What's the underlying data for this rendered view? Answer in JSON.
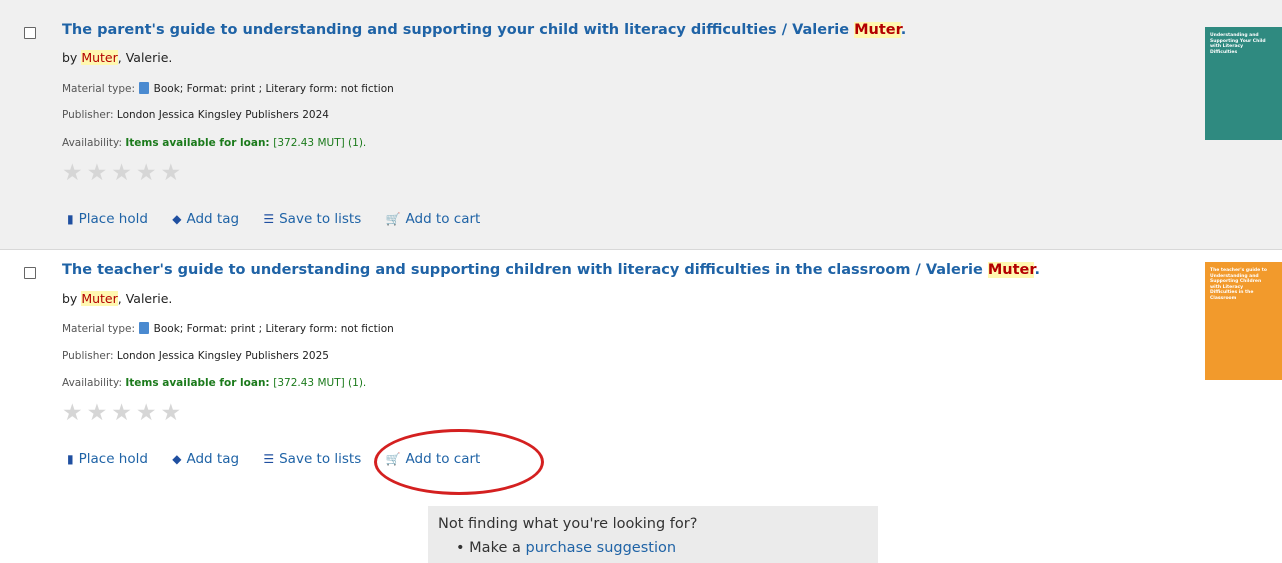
{
  "results": [
    {
      "title": "The parent's guide to understanding and supporting your child with literacy difficulties / Valerie ",
      "title_hl": "Muter",
      "title_end": ".",
      "by_prefix": "by ",
      "author_hl": "Muter",
      "author_rest": ", Valerie.",
      "material_label": "Material type: ",
      "material_value": "Book; Format: print ; Literary form: not fiction",
      "publisher_label": "Publisher: ",
      "publisher_value": "London Jessica Kingsley Publishers 2024",
      "availability_label": "Availability: ",
      "availability_status": "Items available for loan: ",
      "availability_call": "[372.43 MUT] (1).",
      "cover_text": "Understanding and Supporting Your Child with Literacy Difficulties"
    },
    {
      "title": "The teacher's guide to understanding and supporting children with literacy difficulties in the classroom / Valerie ",
      "title_hl": "Muter",
      "title_end": ".",
      "by_prefix": "by ",
      "author_hl": "Muter",
      "author_rest": ", Valerie.",
      "material_label": "Material type: ",
      "material_value": "Book; Format: print ; Literary form: not fiction",
      "publisher_label": "Publisher: ",
      "publisher_value": "London Jessica Kingsley Publishers 2025",
      "availability_label": "Availability: ",
      "availability_status": "Items available for loan: ",
      "availability_call": "[372.43 MUT] (1).",
      "cover_text": "The teacher's guide to Understanding and Supporting Children with Literacy Difficulties in the Classroom"
    }
  ],
  "actions": {
    "place_hold": "Place hold",
    "add_tag": "Add tag",
    "save_to_lists": "Save to lists",
    "add_to_cart": "Add to cart"
  },
  "icons": {
    "hold": "bookmark-icon",
    "tag": "tag-icon",
    "list": "list-icon",
    "cart": "cart-icon",
    "star": "star-icon"
  },
  "colors": {
    "link": "#1f63a6",
    "highlight_bg": "#fff8b0",
    "highlight_text": "#b30000",
    "available": "#1b7a1b",
    "annotation_circle": "#d42020",
    "cover1": "#2f8a80",
    "cover2": "#f29a2c"
  },
  "not_finding": {
    "question": "Not finding what you're looking for?",
    "item_prefix": "Make a ",
    "item_link": "purchase suggestion"
  }
}
